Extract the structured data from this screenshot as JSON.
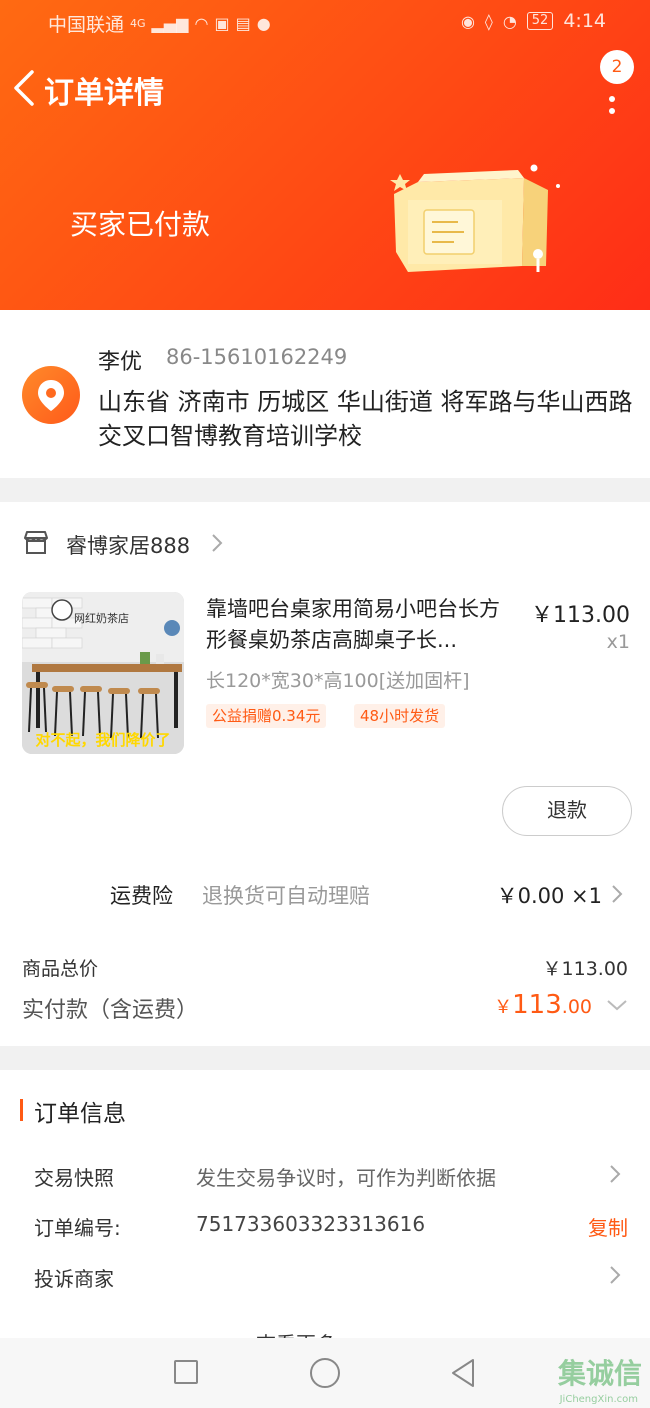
{
  "status_bar": {
    "carrier": "中国联通",
    "network": "4G",
    "battery": "52",
    "time": "4:14"
  },
  "header": {
    "title": "订单详情",
    "message_badge": "2"
  },
  "order_status": "买家已付款",
  "address": {
    "name": "李优",
    "phone": "86-15610162249",
    "full": "山东省 济南市 历城区 华山街道 将军路与华山西路交叉口智博教育培训学校"
  },
  "shop": {
    "name": "睿博家居888"
  },
  "product": {
    "thumb_sign": "网红奶茶店",
    "thumb_banner": "对不起，我们降价了",
    "title": "靠墙吧台桌家用简易小吧台长方形餐桌奶茶店高脚桌子长...",
    "price": "￥113.00",
    "qty": "x1",
    "spec": "长120*宽30*高100[送加固杆]",
    "tags": [
      "公益捐赠0.34元",
      "48小时发货"
    ]
  },
  "refund_button": "退款",
  "shipping_insurance": {
    "label": "运费险",
    "desc": "退换货可自动理赔",
    "value": "￥0.00 ×1"
  },
  "totals": {
    "goods_label": "商品总价",
    "goods_value": "￥113.00",
    "paid_label": "实付款（含运费）",
    "paid_currency": "￥",
    "paid_int": "113",
    "paid_dec": ".00"
  },
  "order_info": {
    "title": "订单信息",
    "snapshot_label": "交易快照",
    "snapshot_value": "发生交易争议时，可作为判断依据",
    "number_label": "订单编号:",
    "number_value": "751733603323313616",
    "copy_label": "复制",
    "complain_label": "投诉商家",
    "more_label": "查看更多"
  },
  "watermark": {
    "main": "集诚信",
    "sub": "JiChengXin.com"
  },
  "colors": {
    "accent": "#ff5a14",
    "hero_start": "#ff6a12",
    "hero_end": "#ff2d17"
  }
}
